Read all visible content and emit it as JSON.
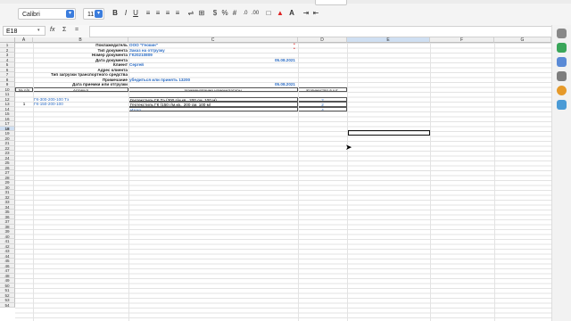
{
  "toolbar": {
    "font_name": "Calibri",
    "font_size": "11",
    "bold_icon": "B",
    "italic_icon": "I",
    "underline_icon": "U",
    "style_box": "",
    "top_box": ""
  },
  "formula_bar": {
    "cell_ref": "E18",
    "fx_icon": "fx",
    "sum_icon": "Σ",
    "equals_icon": "=",
    "content": ""
  },
  "columns": [
    "A",
    "B",
    "C",
    "D",
    "E",
    "F",
    "G"
  ],
  "selected_column": "E",
  "rows": [
    "1",
    "2",
    "3",
    "4",
    "5",
    "6",
    "7",
    "8",
    "9",
    "10",
    "11",
    "12",
    "13",
    "14",
    "15",
    "16",
    "17",
    "18",
    "19",
    "20",
    "21",
    "22",
    "23",
    "24",
    "25",
    "26",
    "27",
    "28",
    "29",
    "30",
    "31",
    "32",
    "33",
    "34",
    "35",
    "36",
    "37",
    "38",
    "39",
    "40",
    "41",
    "42",
    "43",
    "44",
    "45",
    "46",
    "47",
    "48",
    "49",
    "50",
    "51",
    "52",
    "53",
    "54"
  ],
  "selected_row": "18",
  "header_block": {
    "labels": [
      "Поклажедатель",
      "Тип документа",
      "Номер документа",
      "Дата документа",
      "Клиент",
      "Адрес клиента",
      "Тип  загрузки транспортного средства",
      "Примечание",
      "Дата приемки или отгрузки"
    ],
    "values": [
      "ООО \"Геокин\"",
      "Заказ на отгрузку",
      "ГК20210809",
      "",
      "Сергей",
      "",
      "",
      "убедиться или принять 13200",
      ""
    ],
    "date_doc": "05.08.2021",
    "date_accept": "05.08.2021"
  },
  "table": {
    "headers": [
      "№ п/п",
      "Артикул",
      "Наименование номенклатуры",
      "Количество в шт."
    ],
    "rows": [
      {
        "num": "",
        "sku": "ГК-300-200-100 Тэ",
        "name": "Геотекстиль ГК Тэ (300 г/м.кв., 200 см, 100 м)",
        "qty": "2"
      },
      {
        "num": "1",
        "sku": "ГК-150-200-100",
        "name": "Геотекстиль ГК (150 г/м.кв., 200 см, 100 м)",
        "qty": "2"
      }
    ],
    "total_label": "Итого",
    "total_qty": "4"
  },
  "colors": {
    "accent": "#2b6cc4",
    "selection": "#cfdff2",
    "warning_mark": "#d22222"
  }
}
